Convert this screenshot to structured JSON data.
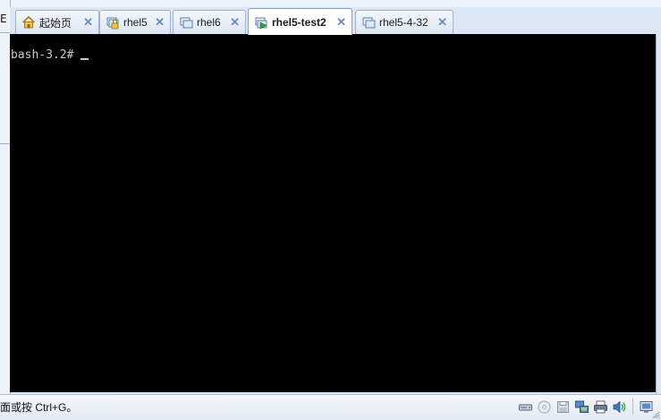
{
  "tabs": [
    {
      "label": "起始页",
      "icon": "home-icon",
      "active": false
    },
    {
      "label": "rhel5",
      "icon": "vm-locked-icon",
      "active": false
    },
    {
      "label": "rhel6",
      "icon": "vm-icon",
      "active": false
    },
    {
      "label": "rhel5-test2",
      "icon": "vm-running-icon",
      "active": true
    },
    {
      "label": "rhel5-4-32",
      "icon": "vm-icon",
      "active": false
    }
  ],
  "terminal": {
    "prompt": "bash-3.2#"
  },
  "status": {
    "text": "面或按 Ctrl+G。"
  },
  "left_panel": {
    "glyph": "E"
  },
  "status_icons": [
    "hard-disk-icon",
    "cd-rom-icon",
    "floppy-icon",
    "network-icon",
    "printer-icon",
    "sound-icon",
    "display-icon"
  ]
}
